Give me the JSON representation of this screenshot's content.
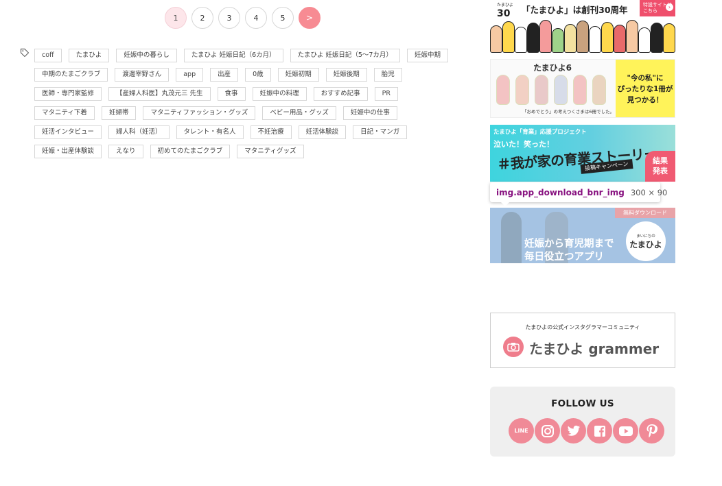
{
  "pagination": {
    "pages": [
      "1",
      "2",
      "3",
      "4",
      "5"
    ],
    "current": "1",
    "next": ">"
  },
  "tags": [
    "coff",
    "たまひよ",
    "妊娠中の暮らし",
    "たまひよ 妊娠日記（6カ月）",
    "たまひよ 妊娠日記（5～7カ月）",
    "妊娠中期",
    "中期のたまごクラブ",
    "渡邊宰野さん",
    "app",
    "出産",
    "0歳",
    "妊娠初期",
    "妊娠後期",
    "胎児",
    "医師・専門家監修",
    "【産婦人科医】丸茂元三 先生",
    "食事",
    "妊娠中の料理",
    "おすすめ記事",
    "PR",
    "マタニティ下着",
    "妊婦帯",
    "マタニティファッション・グッズ",
    "ベビー用品・グッズ",
    "妊娠中の仕事",
    "妊活インタビュー",
    "婦人科（妊活）",
    "タレント・有名人",
    "不妊治療",
    "妊活体験談",
    "日記・マンガ",
    "妊娠・出産体験談",
    "えなり",
    "初めてのたまごクラブ",
    "マタニティグッズ"
  ],
  "banners": {
    "anniversary": {
      "logo": "30",
      "logo_small": "たまひよ",
      "headline": "「たまひよ」は創刊30周年",
      "special": "特設サイトはこちら",
      "arrow": "›"
    },
    "book": {
      "title": "たまひよ6",
      "highlight_1": "\"今の私\"に",
      "highlight_2": "ぴったりな1冊が",
      "highlight_3": "見つかる！",
      "caption": "「おめでとう」の考えつくさまは6冊でした。"
    },
    "story": {
      "pretitle": "たまひよ「育業」応援プロジェクト",
      "laugh": "泣いた！笑った！",
      "headline": "＃我が家の育業ストーリー",
      "tape": "投稿キャンペーン",
      "result_1": "結果",
      "result_2": "発表"
    },
    "app": {
      "ribbon": "無料ダウンロード",
      "line1": "妊娠から育児期まで",
      "line2": "毎日役立つアプリ",
      "logo_small": "まいにちの",
      "logo_big": "たまひよ"
    },
    "grammer": {
      "sub": "たまひよの公式インスタグラマーコミュニティ",
      "brand": "たまひよ grammer"
    }
  },
  "tooltip": {
    "selector": "img.app_download_bnr_img",
    "dims": "300 × 90"
  },
  "follow": {
    "title": "FOLLOW US",
    "line": "LINE"
  },
  "colors": {
    "accent": "#f78b93",
    "current_page": "#fde6ea",
    "social": "#f08a97"
  }
}
